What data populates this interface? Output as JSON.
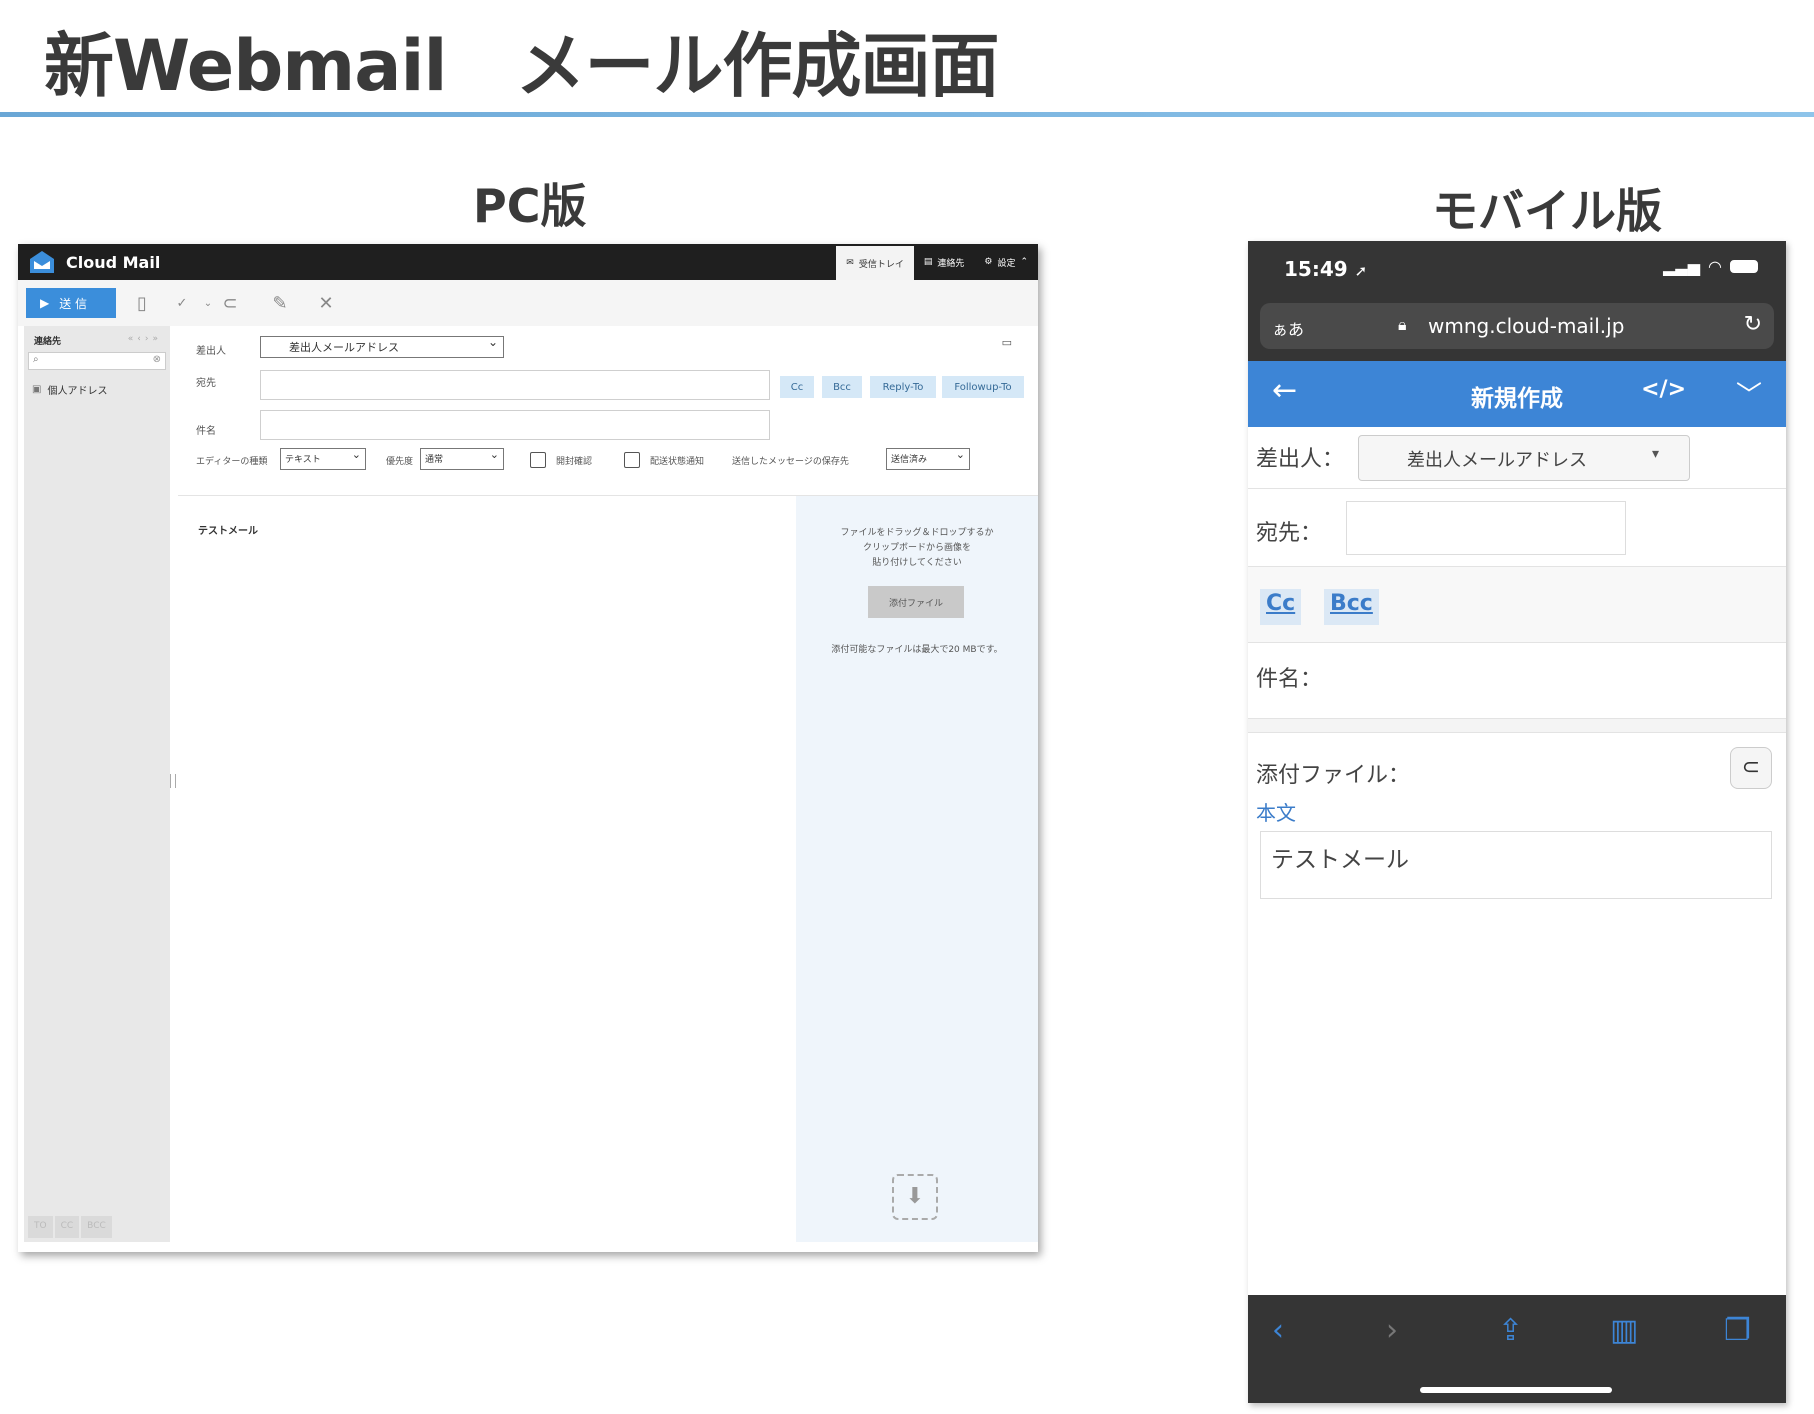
{
  "slide": {
    "title": "新Webmail　メール作成画面",
    "pc_label": "PC版",
    "mobile_label": "モバイル版"
  },
  "pc": {
    "app_name": "Cloud Mail",
    "tabs": [
      {
        "icon": "inbox-icon",
        "label": "受信トレイ",
        "active": true
      },
      {
        "icon": "contacts-icon",
        "label": "連絡先",
        "active": false
      },
      {
        "icon": "gear-icon",
        "label": "設定",
        "active": false
      }
    ],
    "send_label": "送 信",
    "sidebar": {
      "header": "連絡先",
      "pager": "«‹›»",
      "item": "個人アドレス",
      "bottom_tabs": [
        "TO",
        "CC",
        "BCC"
      ]
    },
    "form": {
      "from_label": "差出人",
      "from_value": "差出人メールアドレス",
      "to_label": "宛先",
      "subject_label": "件名",
      "addr_buttons": [
        "Cc",
        "Bcc",
        "Reply-To",
        "Followup-To"
      ],
      "editor_label": "エディターの種類",
      "editor_value": "テキスト",
      "priority_label": "優先度",
      "priority_value": "通常",
      "read_receipt_label": "開封確認",
      "delivery_notice_label": "配送状態通知",
      "save_folder_label": "送信したメッセージの保存先",
      "save_folder_value": "送信済み"
    },
    "body_text": "テストメール",
    "attach": {
      "hint_lines": [
        "ファイルをドラッグ＆ドロップするか",
        "クリップボードから画像を",
        "貼り付けしてください"
      ],
      "button": "添付ファイル",
      "limit": "添付可能なファイルは最大で20 MBです。"
    }
  },
  "mobile": {
    "time": "15:49",
    "aa": "ぁあ",
    "url": "wmng.cloud-mail.jp",
    "app_title": "新規作成",
    "from_label": "差出人：",
    "from_value": "差出人メールアドレス",
    "to_label": "宛先：",
    "cc": "Cc",
    "bcc": "Bcc",
    "subject_label": "件名：",
    "attach_label": "添付ファイル：",
    "body_label": "本文",
    "body_value": "テストメール"
  },
  "colors": {
    "accent": "#3d85d6",
    "title_rule": "#6aa7d6",
    "pc_topbar": "#1f1f1f",
    "mobile_chrome": "#353535"
  }
}
